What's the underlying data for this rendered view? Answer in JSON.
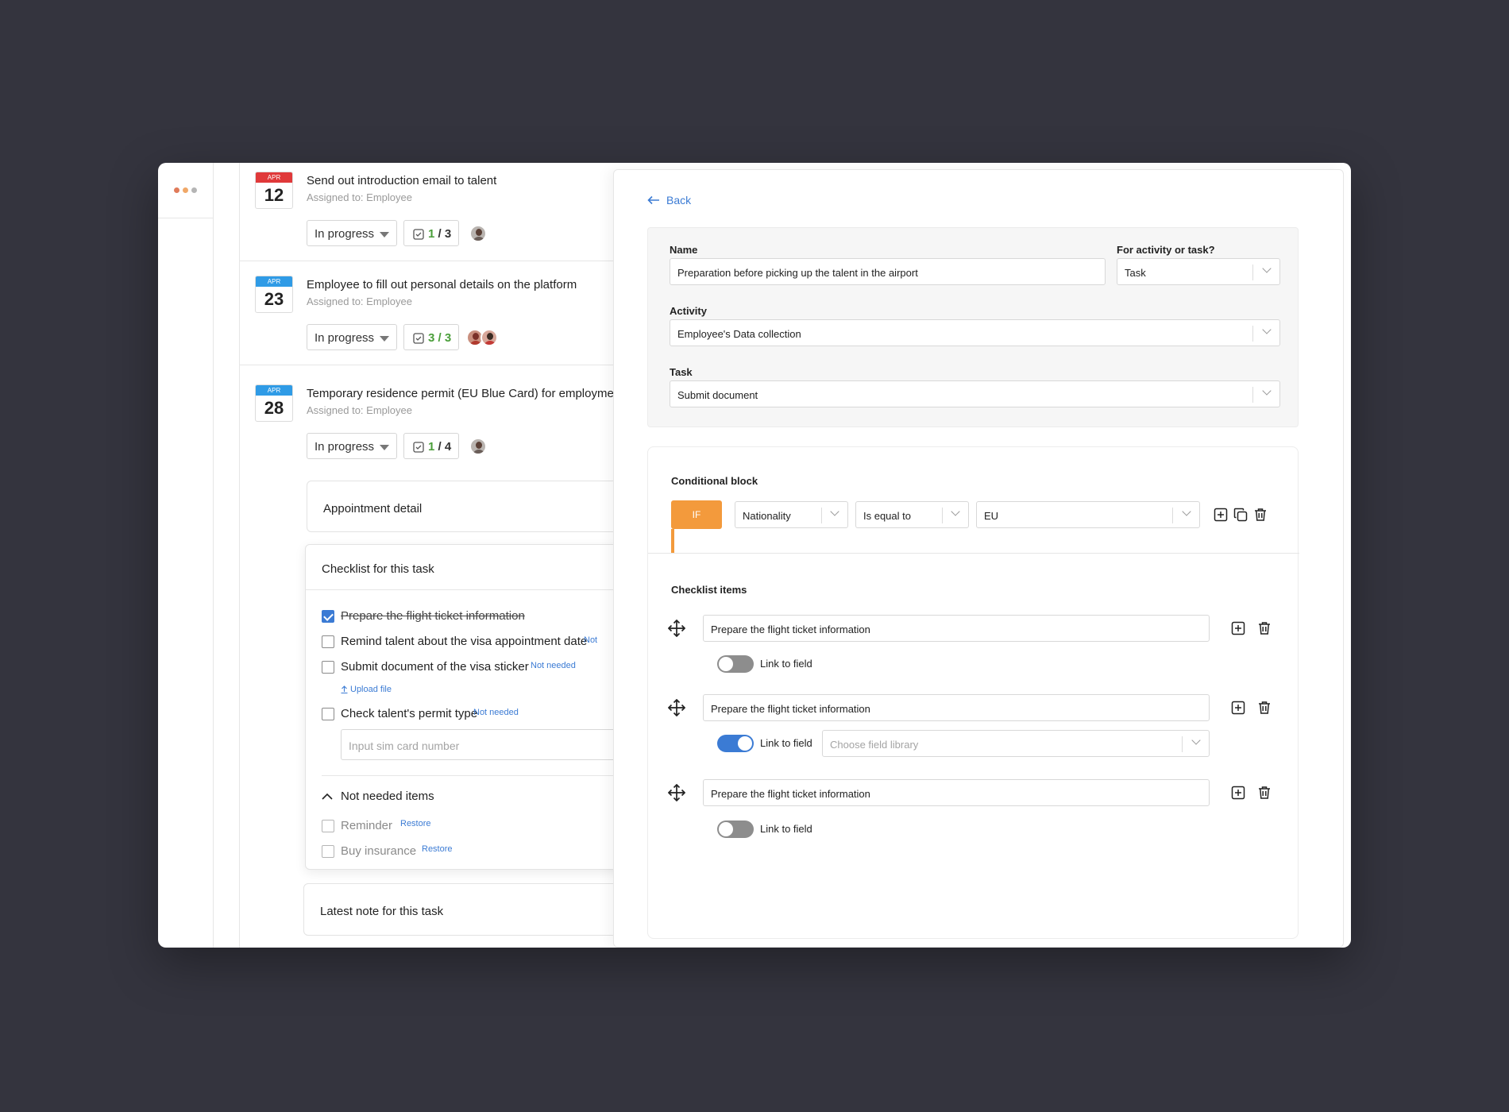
{
  "colors": {
    "background": "#34343e",
    "accent": "#3b7bd4",
    "if_orange": "#f39a3c",
    "counter_green": "#4a9e3a",
    "cal_red": "#e0393a",
    "cal_blue": "#2f9be6",
    "dots": [
      "#e07b5a",
      "#f0a868",
      "#b5b5b5"
    ]
  },
  "tasks": [
    {
      "month": "APR",
      "day": "12",
      "title": "Send out introduction email to talent",
      "assigned": "Assigned to: Employee",
      "status": "In progress",
      "done": "1",
      "total": "3"
    },
    {
      "month": "APR",
      "day": "23",
      "title": "Employee to fill out personal details on the platform",
      "assigned": "Assigned to: Employee",
      "status": "In progress",
      "done": "3",
      "total": "3"
    },
    {
      "month": "APR",
      "day": "28",
      "title": "Temporary residence permit (EU Blue Card) for employmen",
      "assigned": "Assigned to: Employee",
      "status": "In progress",
      "done": "1",
      "total": "4"
    }
  ],
  "appointment": {
    "label": "Appointment detail"
  },
  "checklist": {
    "title": "Checklist for this task",
    "items": [
      {
        "label": "Prepare the flight ticket information",
        "checked": true
      },
      {
        "label": "Remind talent about the visa appointment date",
        "tag": "Not"
      },
      {
        "label": "Submit document of the visa sticker",
        "tag": "Not needed"
      },
      {
        "label": "Check talent's permit type",
        "tag": "Not needed"
      }
    ],
    "upload": "Upload file",
    "sim_placeholder": "Input sim card number",
    "not_needed_title": "Not needed items",
    "not_needed": [
      {
        "label": "Reminder",
        "action": "Restore"
      },
      {
        "label": "Buy insurance",
        "action": "Restore"
      }
    ]
  },
  "latest_note": {
    "label": "Latest note for this task"
  },
  "panel": {
    "back": "Back",
    "name_label": "Name",
    "name_value": "Preparation before picking up the talent in the airport",
    "for_label": "For activity or task?",
    "for_value": "Task",
    "activity_label": "Activity",
    "activity_value": "Employee's Data collection",
    "task_label": "Task",
    "task_value": "Submit document",
    "cond_title": "Conditional block",
    "if_label": "IF",
    "field": "Nationality",
    "operator": "Is equal to",
    "value": "EU",
    "checklist_title": "Checklist items",
    "rows": [
      {
        "text": "Prepare the flight ticket information",
        "link_label": "Link to field",
        "linked": false
      },
      {
        "text": "Prepare the flight ticket information",
        "link_label": "Link to field",
        "linked": true,
        "library_placeholder": "Choose field library"
      },
      {
        "text": "Prepare the flight ticket information",
        "link_label": "Link to field",
        "linked": false
      }
    ]
  }
}
